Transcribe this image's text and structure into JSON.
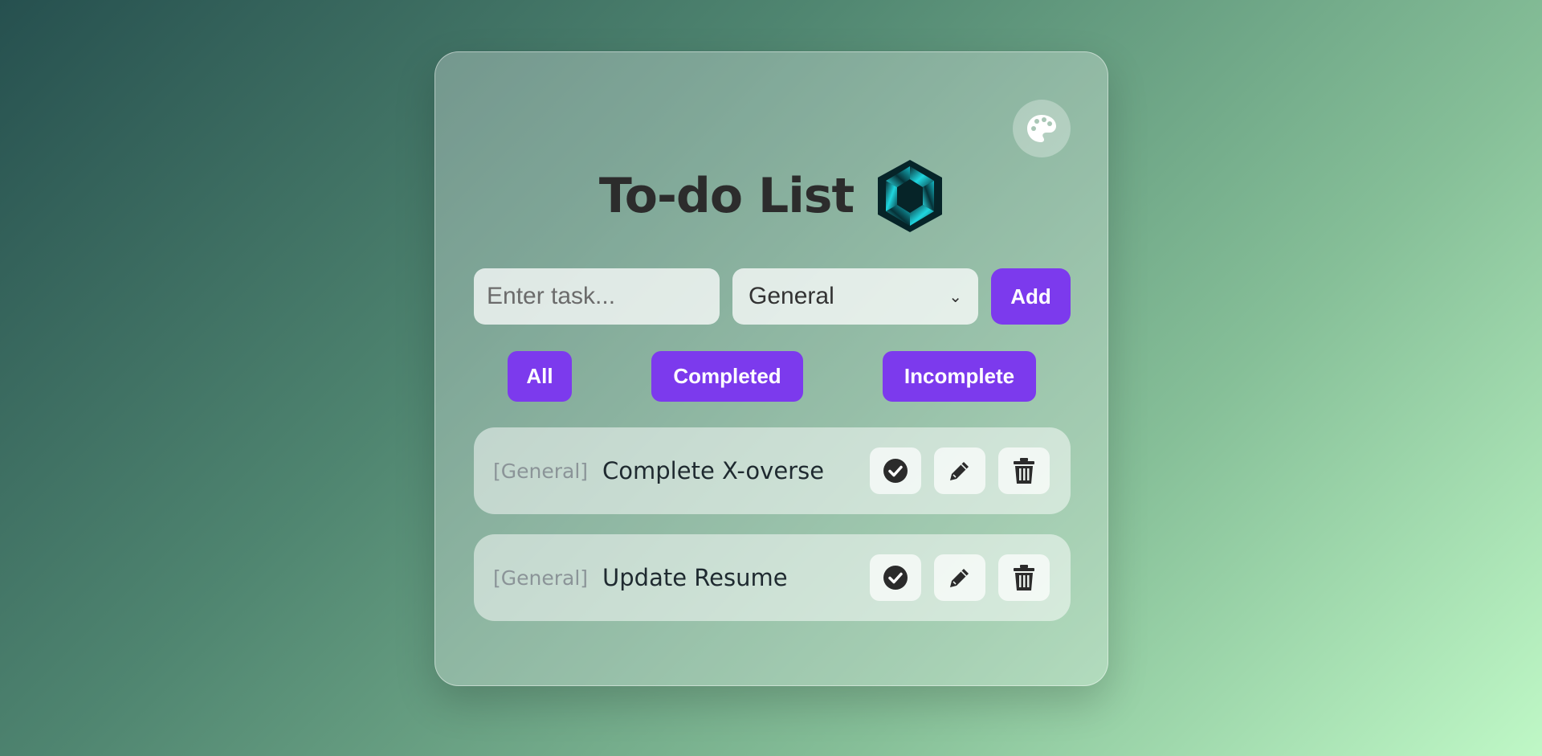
{
  "app": {
    "title": "To-do List",
    "logo_icon": "hexagon-ribbon-logo",
    "theme_icon": "palette-icon"
  },
  "form": {
    "task_placeholder": "Enter task...",
    "task_value": "",
    "category_selected": "General",
    "add_label": "Add"
  },
  "filters": [
    {
      "label": "All"
    },
    {
      "label": "Completed"
    },
    {
      "label": "Incomplete"
    }
  ],
  "tasks": [
    {
      "category": "[General]",
      "text": "Complete X-overse"
    },
    {
      "category": "[General]",
      "text": "Update Resume"
    }
  ],
  "colors": {
    "accent": "#7c3aed",
    "title_text": "#2c2c2c",
    "logo_teal": "#16c6cf"
  }
}
